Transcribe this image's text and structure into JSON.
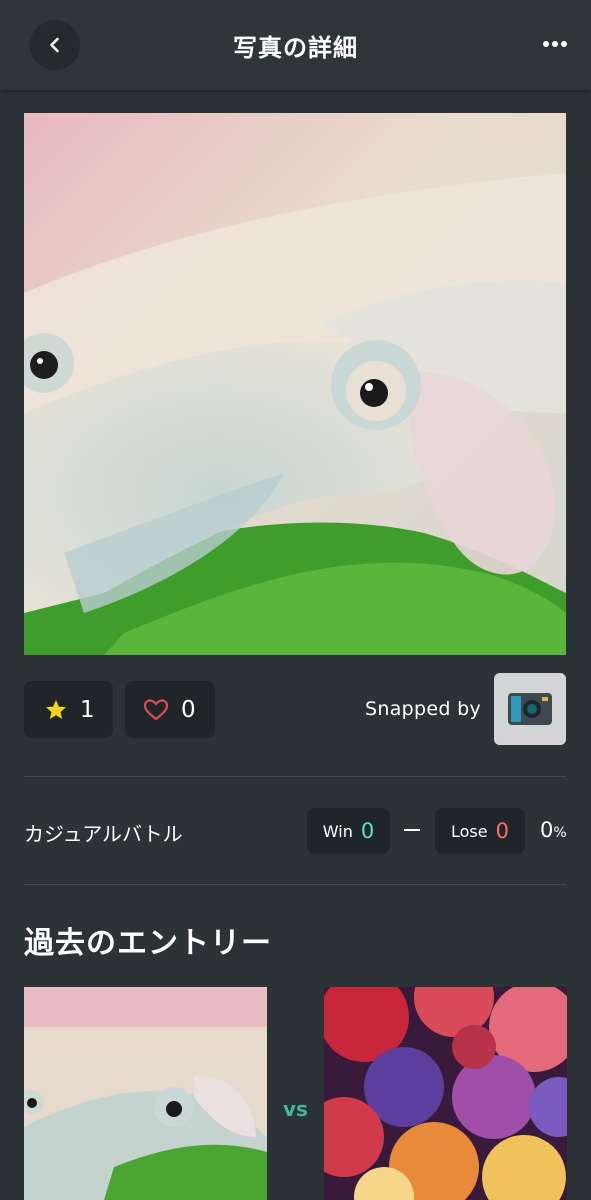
{
  "header": {
    "title": "写真の詳細"
  },
  "stats": {
    "stars": "1",
    "likes": "0",
    "snapped_by_label": "Snapped by"
  },
  "battle": {
    "label": "カジュアルバトル",
    "win_label": "Win",
    "win_count": "0",
    "lose_label": "Lose",
    "lose_count": "0",
    "rate_value": "0",
    "rate_unit": "%"
  },
  "past_entries": {
    "title": "過去のエントリー",
    "vs_label": "vs"
  },
  "colors": {
    "background": "#2c3336",
    "win_accent": "#5ee3b8",
    "lose_accent": "#ff6b6b",
    "star": "#f5d020",
    "heart": "#e04a55",
    "vs": "#3fb89a"
  },
  "icons": {
    "back": "chevron-left-icon",
    "more": "more-dots-icon",
    "star": "star-icon",
    "heart": "heart-outline-icon",
    "camera": "camera-icon"
  }
}
